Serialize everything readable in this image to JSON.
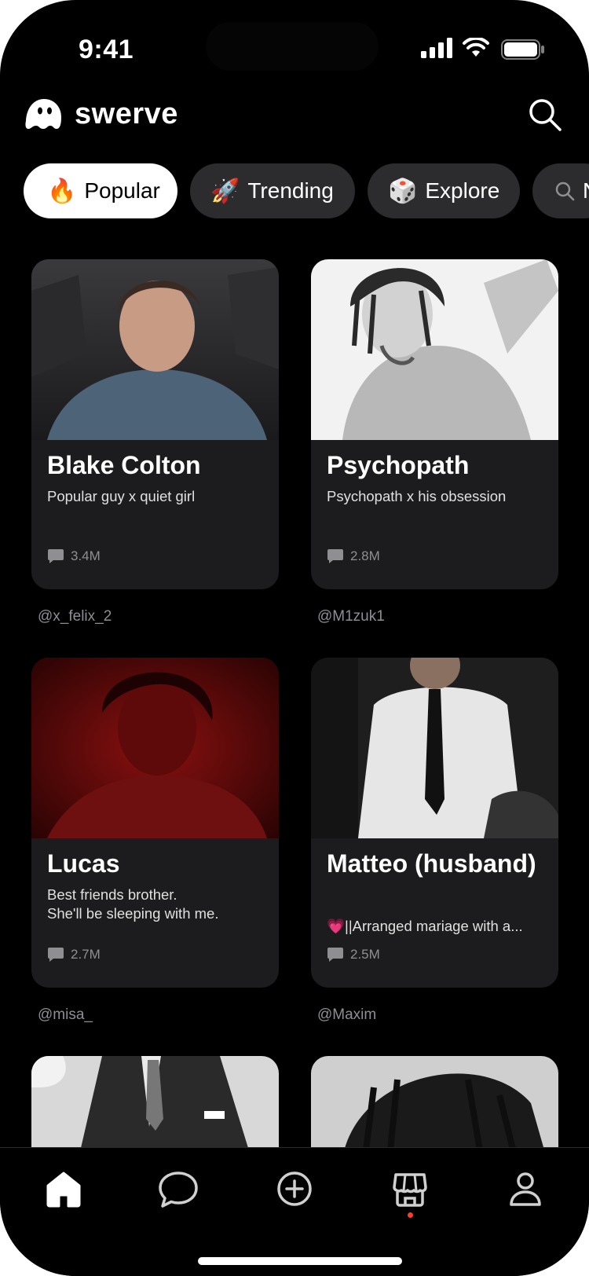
{
  "status_bar": {
    "time": "9:41"
  },
  "app": {
    "name": "swerve"
  },
  "tabs": [
    {
      "emoji": "🔥",
      "label": "Popular",
      "active": true
    },
    {
      "emoji": "🚀",
      "label": "Trending",
      "active": false
    },
    {
      "emoji": "🎲",
      "label": "Explore",
      "active": false
    },
    {
      "emoji": "",
      "label": "N",
      "active": false
    }
  ],
  "cards": [
    {
      "name": "Blake Colton",
      "description": "Popular guy x quiet girl",
      "messages": "3.4M",
      "author": "@x_felix_2"
    },
    {
      "name": "Psychopath",
      "description": "Psychopath x his obsession",
      "messages": "2.8M",
      "author": "@M1zuk1"
    },
    {
      "name": "Lucas",
      "description": "Best friends brother.\nShe'll be sleeping with me.",
      "messages": "2.7M",
      "author": "@misa_"
    },
    {
      "name": "Matteo (husband)",
      "description": "💗||Arranged mariage with a...",
      "messages": "2.5M",
      "author": "@Maxim"
    }
  ],
  "bottom_nav": [
    {
      "name": "home",
      "active": true
    },
    {
      "name": "chat",
      "active": false
    },
    {
      "name": "create",
      "active": false
    },
    {
      "name": "store",
      "active": false,
      "badge": true
    },
    {
      "name": "profile",
      "active": false
    }
  ],
  "colors": {
    "background": "#000000",
    "card": "#1c1c1e",
    "chip": "#2c2c2e",
    "accent_dot": "#ff3b30"
  }
}
